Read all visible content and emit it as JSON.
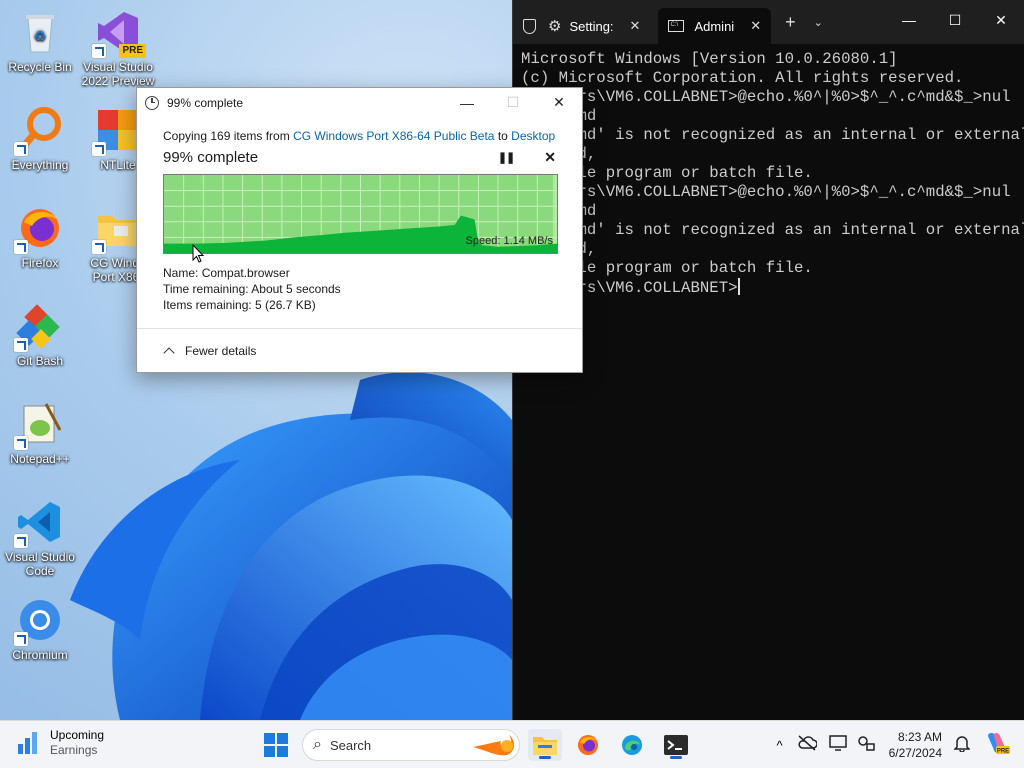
{
  "desktop": {
    "icons": [
      {
        "label": "Recycle Bin"
      },
      {
        "label": "Visual Studio 2022 Preview",
        "badge": "PRE"
      },
      {
        "label": "Everything"
      },
      {
        "label": "NTLite"
      },
      {
        "label": "Firefox"
      },
      {
        "label": "CG Windo Port X86-"
      },
      {
        "label": "Git Bash"
      },
      {
        "label": "Notepad++"
      },
      {
        "label": "Visual Studio Code"
      },
      {
        "label": "Chromium"
      }
    ]
  },
  "copy_dialog": {
    "title": "99% complete",
    "copying_prefix": "Copying 169 items from ",
    "source": "CG Windows Port X86-64 Public Beta",
    "to_word": " to ",
    "destination": "Desktop",
    "headline": "99% complete",
    "pause_glyph": "❚❚",
    "cancel_glyph": "✕",
    "speed": "Speed: 1.14 MB/s",
    "name_label": "Name:",
    "name_value": "Compat.browser",
    "time_label": "Time remaining:",
    "time_value": "About 5 seconds",
    "items_label": "Items remaining:",
    "items_value": "5 (26.7 KB)",
    "fewer_details": "Fewer details",
    "progress_fraction": 0.99,
    "titlebar_controls": {
      "minimize": "—",
      "maximize": "☐",
      "close": "✕"
    }
  },
  "chart_data": {
    "type": "area",
    "speed_MBps": 1.14,
    "x": [
      0,
      0.08,
      0.16,
      0.26,
      0.33,
      0.4,
      0.46,
      0.52,
      0.58,
      0.64,
      0.7,
      0.74,
      0.755,
      0.77,
      0.79,
      0.8,
      0.81,
      0.85,
      0.9,
      0.95,
      1.0
    ],
    "y": [
      0.12,
      0.12,
      0.13,
      0.16,
      0.2,
      0.23,
      0.26,
      0.28,
      0.3,
      0.32,
      0.34,
      0.36,
      0.48,
      0.46,
      0.43,
      0.14,
      0.1,
      0.08,
      0.09,
      0.1,
      0.12
    ],
    "colors": {
      "background": "#b0eaa0",
      "fill": "#0cb43a",
      "progress_fill": "#8ad97c",
      "grid": "#c6f0bc"
    }
  },
  "terminal": {
    "tabs": [
      {
        "label": "Setting:",
        "close": "✕"
      },
      {
        "label": "Admini",
        "close": "✕"
      }
    ],
    "new_tab": "+",
    "dropdown": "⌄",
    "window_controls": {
      "minimize": "—",
      "maximize": "☐",
      "close": "✕"
    },
    "lines": [
      "Microsoft Windows [Version 10.0.26080.1]",
      "(c) Microsoft Corporation. All rights reserved.",
      "",
      "C:\\Users\\VM6.COLLABNET>@echo.%0^|%0>$^_^.c^md&$_>nul",
      "'$_^.cmd",
      "'$_^.cmd' is not recognized as an internal or external",
      "command,",
      "operable program or batch file.",
      "",
      "C:\\Users\\VM6.COLLABNET>@echo.%0^|%0>$^_^.c^md&$_>nul",
      "'$_^.cmd",
      "'$_^.cmd' is not recognized as an internal or external",
      "command,",
      "operable program or batch file.",
      "",
      "C:\\Users\\VM6.COLLABNET>"
    ]
  },
  "taskbar": {
    "widget_title": "Upcoming",
    "widget_sub": "Earnings",
    "search_placeholder": "Search",
    "time": "8:23 AM",
    "date": "6/27/2024",
    "tray_chevron": "^"
  },
  "colors": {
    "accent": "#0a64ad",
    "terminal_bg": "#0c0c0c",
    "taskbar_bg": "#f2f4f8"
  }
}
